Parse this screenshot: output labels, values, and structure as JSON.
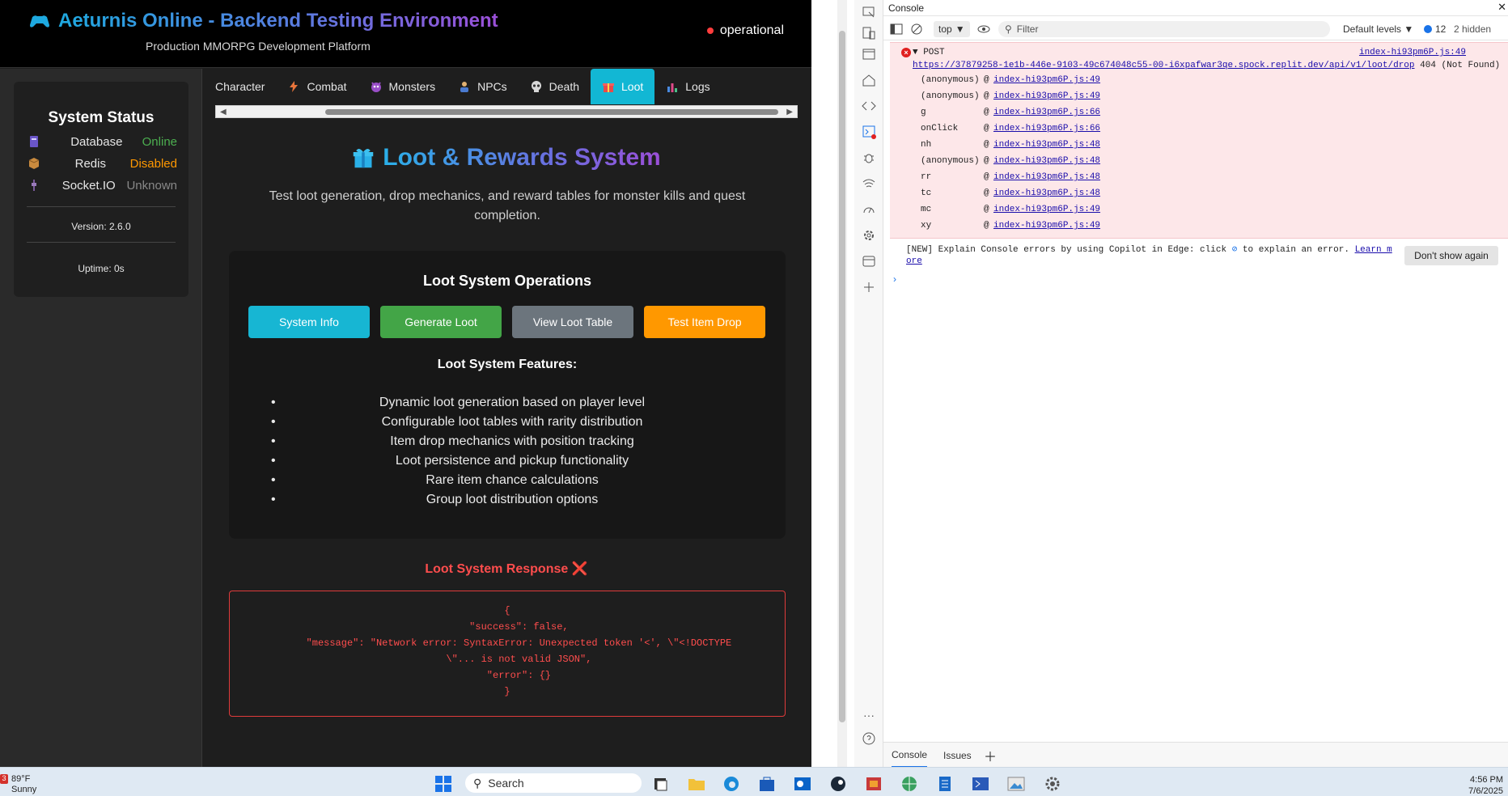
{
  "app": {
    "title": "Aeturnis Online - Backend Testing Environment",
    "subtitle": "Production MMORPG Development Platform",
    "status": "operational"
  },
  "sidebar": {
    "heading": "System Status",
    "rows": [
      {
        "label": "Database",
        "value": "Online",
        "color": "#4caf50"
      },
      {
        "label": "Redis",
        "value": "Disabled",
        "color": "#ff9800"
      },
      {
        "label": "Socket.IO",
        "value": "Unknown",
        "color": "#888888"
      }
    ],
    "version": "Version: 2.6.0",
    "uptime": "Uptime: 0s"
  },
  "tabs": [
    {
      "label": "Character",
      "icon": "none"
    },
    {
      "label": "Combat",
      "icon": "lightning-icon"
    },
    {
      "label": "Monsters",
      "icon": "monster-icon"
    },
    {
      "label": "NPCs",
      "icon": "npc-icon"
    },
    {
      "label": "Death",
      "icon": "skull-icon"
    },
    {
      "label": "Loot",
      "icon": "gift-icon",
      "active": true
    },
    {
      "label": "Logs",
      "icon": "chart-icon"
    }
  ],
  "main": {
    "title": "Loot & Rewards System",
    "description": "Test loot generation, drop mechanics, and reward tables for monster kills and quest completion.",
    "ops_title": "Loot System Operations",
    "buttons": [
      {
        "label": "System Info",
        "color": "#17b6d3"
      },
      {
        "label": "Generate Loot",
        "color": "#43a547"
      },
      {
        "label": "View Loot Table",
        "color": "#6c757d"
      },
      {
        "label": "Test Item Drop",
        "color": "#ff9800"
      }
    ],
    "features_title": "Loot System Features:",
    "features": [
      "Dynamic loot generation based on player level",
      "Configurable loot tables with rarity distribution",
      "Item drop mechanics with position tracking",
      "Loot persistence and pickup functionality",
      "Rare item chance calculations",
      "Group loot distribution options"
    ],
    "response_title": "Loot System Response ❌",
    "response_body": "{\n    \"success\": false,\n    \"message\": \"Network error: SyntaxError: Unexpected token '<', \\\"<!DOCTYPE\n    \\\"... is not valid JSON\",\n    \"error\": {}\n}"
  },
  "devtools": {
    "panel_title": "Console",
    "context": "top",
    "filter_placeholder": "Filter",
    "levels": "Default levels",
    "issues_count": "12",
    "hidden_count": "2 hidden",
    "error": {
      "method": "POST",
      "source": "index-hi93pm6P.js:49",
      "url": "https://37879258-1e1b-446e-9103-49c674048c55-00-i6xpafwar3qe.spock.replit.dev/api/v1/loot/drop",
      "status": "404 (Not Found)",
      "stack": [
        {
          "fn": "(anonymous)",
          "link": "index-hi93pm6P.js:49"
        },
        {
          "fn": "(anonymous)",
          "link": "index-hi93pm6P.js:49"
        },
        {
          "fn": "g",
          "link": "index-hi93pm6P.js:66"
        },
        {
          "fn": "onClick",
          "link": "index-hi93pm6P.js:66"
        },
        {
          "fn": "nh",
          "link": "index-hi93pm6P.js:48"
        },
        {
          "fn": "(anonymous)",
          "link": "index-hi93pm6P.js:48"
        },
        {
          "fn": "rr",
          "link": "index-hi93pm6P.js:48"
        },
        {
          "fn": "tc",
          "link": "index-hi93pm6P.js:48"
        },
        {
          "fn": "mc",
          "link": "index-hi93pm6P.js:49"
        },
        {
          "fn": "xy",
          "link": "index-hi93pm6P.js:49"
        }
      ]
    },
    "tip_prefix": "[NEW] Explain Console errors by using Copilot in Edge: click",
    "tip_suffix": "to explain an error.",
    "tip_link_1": "Learn m",
    "tip_link_2": "ore",
    "dont_show": "Don't show again",
    "bottom_tabs": [
      "Console",
      "Issues"
    ]
  },
  "taskbar": {
    "weather_badge": "3",
    "temperature": "89°F",
    "condition": "Sunny",
    "search": "Search",
    "time": "4:56 PM",
    "date": "7/6/2025"
  }
}
